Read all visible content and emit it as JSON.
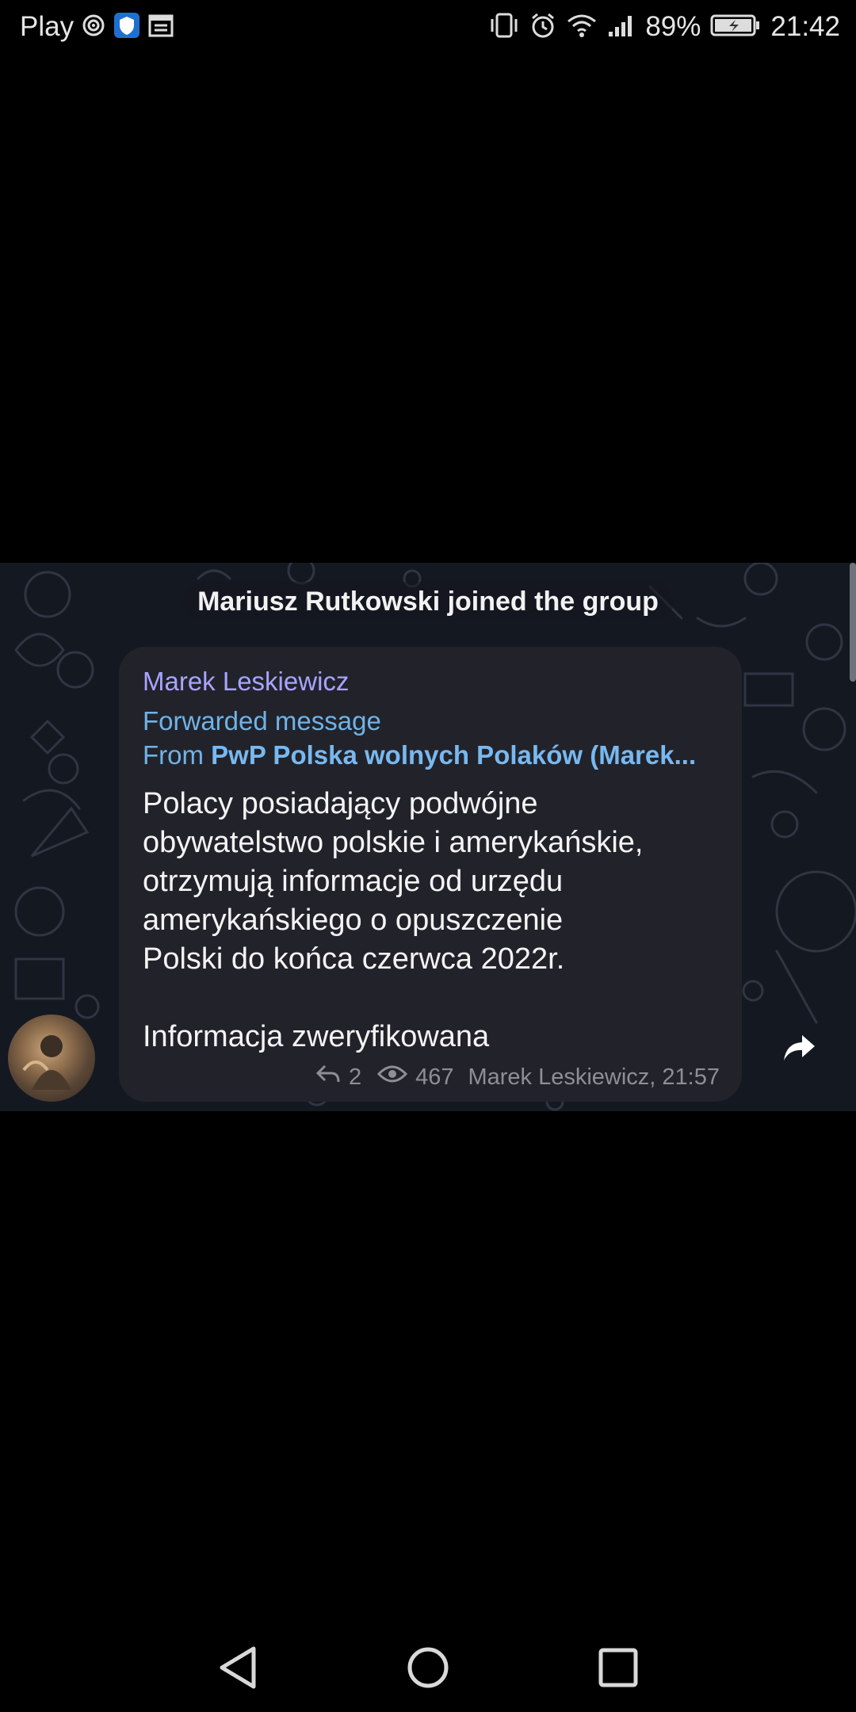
{
  "status_bar": {
    "carrier": "Play",
    "battery_percent": "89%",
    "time": "21:42",
    "icons": [
      "hotspot-icon",
      "shield-icon",
      "calendar-icon",
      "vibrate-icon",
      "alarm-icon",
      "wifi-icon",
      "signal-icon",
      "battery-icon"
    ]
  },
  "chat": {
    "service_message": "Mariusz Rutkowski joined the group",
    "message": {
      "sender": "Marek Leskiewicz",
      "forwarded_label": "Forwarded message",
      "from_prefix": "From ",
      "from_source": "PwP Polska wolnych Polaków (Marek...",
      "text": "Polacy posiadający podwójne\nobywatelstwo polskie i amerykańskie,\notrzymują informacje  od urzędu\namerykańskiego o opuszczenie\nPolski do końca czerwca 2022r.\n\nInformacja zweryfikowana",
      "replies": "2",
      "views": "467",
      "signature": "Marek Leskiewicz, 21:57"
    }
  },
  "nav_bar": {
    "icons": [
      "back-icon",
      "home-icon",
      "recents-icon"
    ]
  },
  "colors": {
    "sender_name": "#a8a4ff",
    "forward_link": "#6fb3e8",
    "bubble": "#22232a",
    "chat_background": "#141821"
  }
}
